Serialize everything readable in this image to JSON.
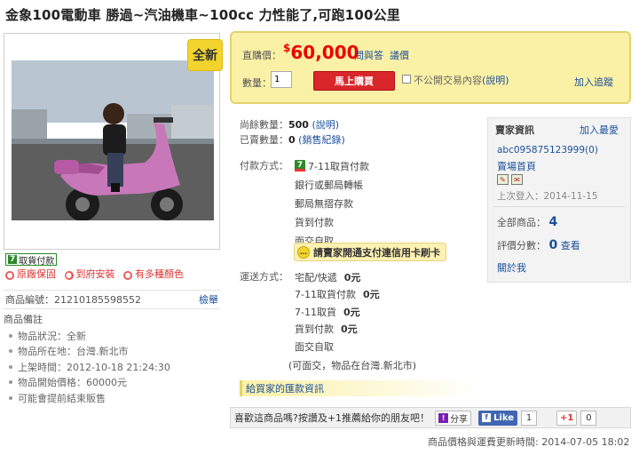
{
  "title": "金象100電動車 勝過~汽油機車~100cc 力性能了,可跑100公里",
  "badge_new": "全新",
  "left": {
    "seven_badge": "取貨付款",
    "seven_mark": "7",
    "tags": [
      "原廠保固",
      "到府安裝",
      "有多種顏色"
    ],
    "item_no_label": "商品編號：21210185598552",
    "report_link": "檢舉",
    "remarks_title": "商品備註",
    "remarks": [
      "物品狀況：全新",
      "物品所在地：台灣.新北市",
      "上架時間：2012-10-18 21:24:30",
      "物品開始價格：60000元",
      "可能會提前結束販售"
    ]
  },
  "price": {
    "label": "直購價：",
    "currency": "$",
    "value": "60,000",
    "qa": "問與答",
    "bargain": "議價",
    "qty_label": "數量：",
    "qty_value": "1",
    "buy": "馬上購買",
    "private_label": "不公開交易內容",
    "private_link": "(說明)",
    "follow": "加入追蹤"
  },
  "stats": {
    "remaining_label": "尚餘數量：",
    "remaining": "500",
    "remaining_link": "(說明)",
    "sold_label": "已賣數量：",
    "sold": "0",
    "sold_link": "(銷售紀錄)"
  },
  "payment": {
    "label": "付款方式：",
    "methods": [
      "7-11取貨付款",
      "銀行或郵局轉帳",
      "郵局無摺存款",
      "貨到付款",
      "面交自取"
    ],
    "card_notice": "請賣家開通支付連信用卡刷卡"
  },
  "shipping": {
    "label": "運送方式：",
    "methods": [
      {
        "name": "宅配/快遞",
        "fee": "0元"
      },
      {
        "name": "7-11取貨付款",
        "fee": "0元"
      },
      {
        "name": "7-11取貨",
        "fee": "0元"
      },
      {
        "name": "貨到付款",
        "fee": "0元"
      },
      {
        "name": "面交自取",
        "fee": ""
      }
    ],
    "pickup_note": "(可面交，物品在台灣.新北市)",
    "remit_info": "給買家的匯款資訊"
  },
  "seller": {
    "heading": "賣家資訊",
    "add_fav": "加入最愛",
    "name": "abc095875123999(0)",
    "store_home": "賣場首頁",
    "last_login": "上次登入：2014-11-15",
    "total_label": "全部商品：",
    "total": "4",
    "rating_label": "評價分數：",
    "rating": "0",
    "rating_link": "查看",
    "about": "關於我"
  },
  "share": {
    "text": "喜歡這商品嗎?按讚及+1推薦給你的朋友吧！",
    "yahoo": "分享",
    "fb": "Like",
    "fb_count": "1",
    "gplus": "+1",
    "gplus_count": "0"
  },
  "updated": "商品價格與運費更新時間: 2014-07-05  18:02",
  "colors": {
    "price": "#e00000",
    "buy_button": "#d8262b",
    "price_box": "#fbf1a6",
    "link": "#1a4f9c"
  }
}
